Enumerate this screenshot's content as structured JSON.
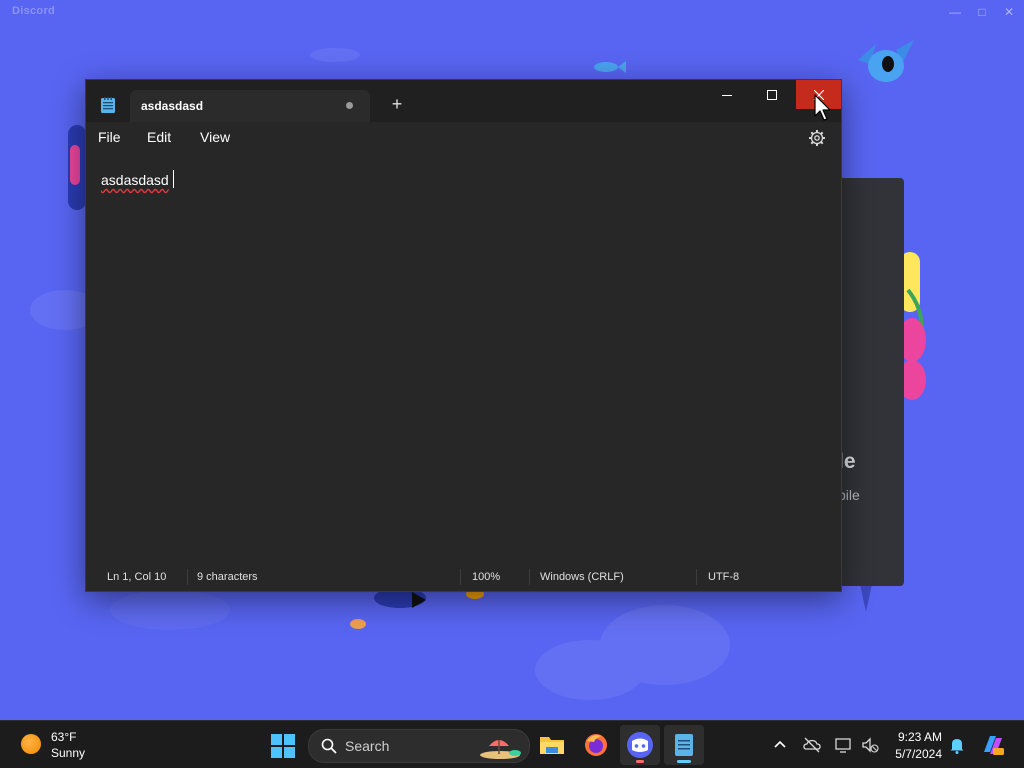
{
  "background_window": {
    "title": "Discord",
    "card_text_line1": "le",
    "card_text_line2": "bile",
    "accent_color": "#5865f2"
  },
  "notepad": {
    "tab_title": "asdasdasd",
    "tab_unsaved": true,
    "menu": {
      "file": "File",
      "edit": "Edit",
      "view": "View"
    },
    "editor_text": "asdasdasd",
    "status": {
      "position": "Ln 1, Col 10",
      "characters": "9 characters",
      "zoom": "100%",
      "line_ending": "Windows (CRLF)",
      "encoding": "UTF-8"
    },
    "close_button_color": "#c42b1c"
  },
  "taskbar": {
    "weather": {
      "temperature": "63°F",
      "condition": "Sunny",
      "icon": "sun-icon"
    },
    "search_label": "Search",
    "pinned_apps": [
      {
        "name": "file-explorer-icon"
      },
      {
        "name": "firefox-icon"
      },
      {
        "name": "discord-icon"
      },
      {
        "name": "notepad-icon"
      }
    ],
    "clock": {
      "time": "9:23 AM",
      "date": "5/7/2024"
    }
  }
}
